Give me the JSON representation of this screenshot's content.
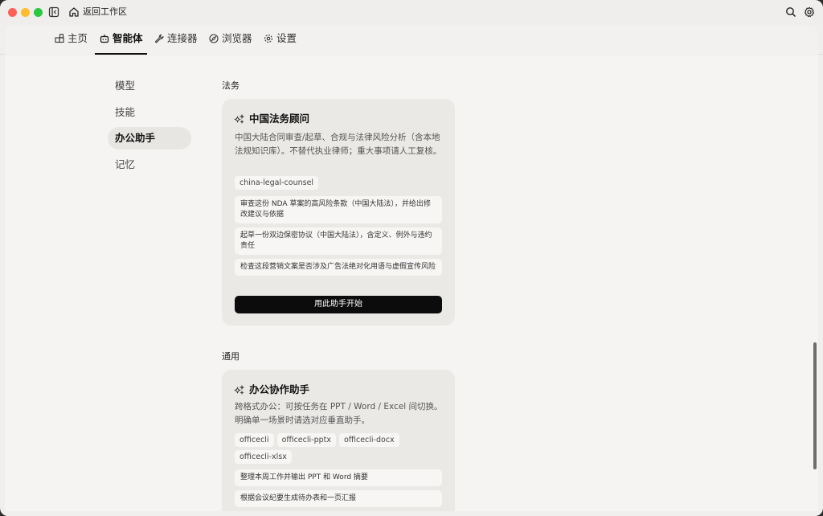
{
  "titlebar": {
    "back_label": "返回工作区"
  },
  "nav": {
    "tabs": [
      {
        "label": "主页",
        "icon": "home-grid-icon"
      },
      {
        "label": "智能体",
        "icon": "robot-icon",
        "active": true
      },
      {
        "label": "连接器",
        "icon": "wrench-icon"
      },
      {
        "label": "浏览器",
        "icon": "compass-icon"
      },
      {
        "label": "设置",
        "icon": "gear-icon"
      }
    ]
  },
  "sidebar": {
    "items": [
      {
        "label": "模型"
      },
      {
        "label": "技能"
      },
      {
        "label": "办公助手",
        "active": true
      },
      {
        "label": "记忆"
      }
    ]
  },
  "sections": [
    {
      "title": "法务",
      "card": {
        "title": "中国法务顾问",
        "description": "中国大陆合同审查/起草、合规与法律风险分析（含本地法规知识库）。不替代执业律师；重大事项请人工复核。",
        "tags": [
          "china-legal-counsel"
        ],
        "prompts": [
          "审查这份 NDA 草案的高风险条款（中国大陆法），并给出修改建议与依据",
          "起草一份双边保密协议（中国大陆法），含定义、例外与违约责任",
          "检查这段营销文案是否涉及广告法绝对化用语与虚假宣传风险"
        ],
        "start_label": "用此助手开始"
      }
    },
    {
      "title": "通用",
      "card": {
        "title": "办公协作助手",
        "description": "跨格式办公：可按任务在 PPT / Word / Excel 间切换。明确单一场景时请选对应垂直助手。",
        "tags": [
          "officecli",
          "officecli-pptx",
          "officecli-docx",
          "officecli-xlsx"
        ],
        "prompts": [
          "整理本周工作并输出 PPT 和 Word 摘要",
          "根据会议纪要生成待办表和一页汇报"
        ]
      }
    }
  ],
  "colors": {
    "accent": "#0c0c0c",
    "card_bg": "#ebe9e6",
    "content_bg": "#f5f4f2"
  }
}
